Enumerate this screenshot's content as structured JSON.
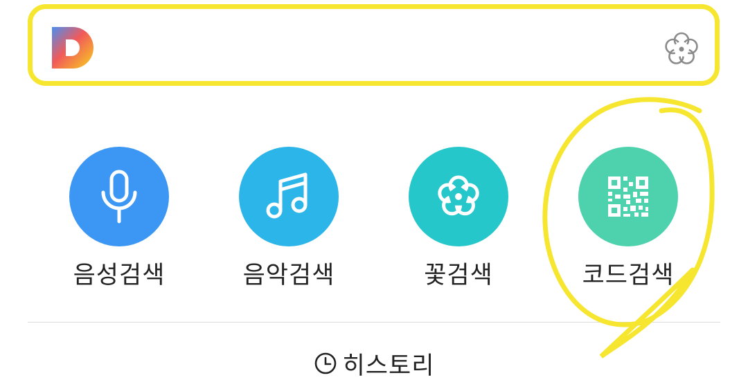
{
  "search": {
    "logo_icon": "daum-logo-icon",
    "flower_icon": "flower-icon"
  },
  "shortcuts": [
    {
      "label": "음성검색",
      "icon": "microphone-icon",
      "color": "#3b97f3"
    },
    {
      "label": "음악검색",
      "icon": "music-note-icon",
      "color": "#2bb5e8"
    },
    {
      "label": "꽃검색",
      "icon": "flower-icon",
      "color": "#25c7cb"
    },
    {
      "label": "코드검색",
      "icon": "qr-code-icon",
      "color": "#4dd2ad"
    }
  ],
  "history": {
    "label": "히스토리",
    "icon": "clock-icon"
  },
  "colors": {
    "highlight": "#f6e630"
  }
}
